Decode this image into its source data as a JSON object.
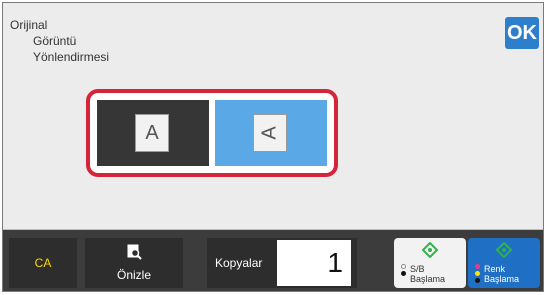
{
  "header": {
    "title_line1": "Orijinal",
    "title_line2": "Görüntü",
    "title_line3": "Yönlendirmesi",
    "ok_label": "OK"
  },
  "orientation": {
    "portrait_icon_letter": "A",
    "landscape_icon_letter": "A",
    "selected": "landscape"
  },
  "bottom": {
    "ca_label": "CA",
    "preview_label": "Önizle",
    "copies_label": "Kopyalar",
    "copies_value": "1",
    "bw_start_line1": "S/B",
    "bw_start_line2": "Başlama",
    "color_start_line1": "Renk",
    "color_start_line2": "Başlama"
  },
  "colors": {
    "accent": "#2e7fcb",
    "selection_border": "#d6243a",
    "ca_text": "#ffd400",
    "start_icon": "#33b24a"
  }
}
